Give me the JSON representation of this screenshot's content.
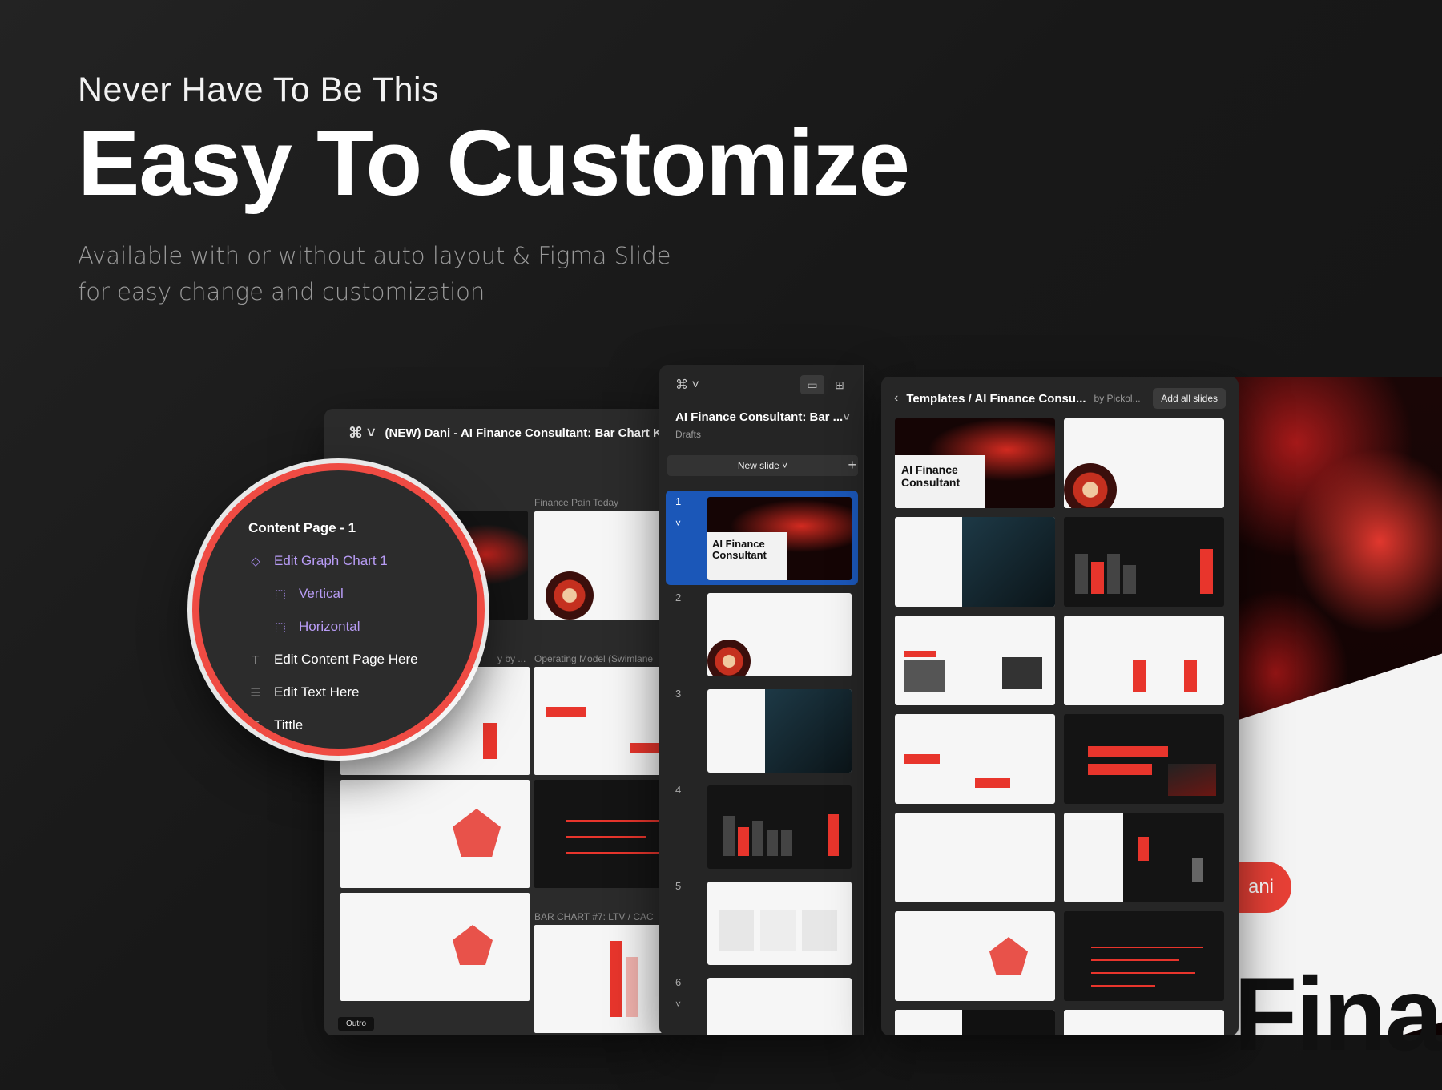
{
  "hero": {
    "kicker": "Never Have To Be This",
    "title": "Easy To Customize",
    "subtitle_line1": "Available with or without auto layout  & Figma Slide",
    "subtitle_line2": "for easy change and customization"
  },
  "back_window": {
    "file_title": "(NEW) Dani - AI Finance Consultant: Bar Chart KPI",
    "labels": {
      "finance_pain": "Finance Pain Today",
      "operating_model": "Operating Model (Swimlane",
      "by": "y by ...",
      "bar_chart7": "BAR CHART #7: LTV / CAC"
    },
    "outro": "Outro"
  },
  "layers": {
    "root": "Content Page - 1",
    "items": [
      {
        "label": "Edit Graph Chart 1",
        "icon": "component-icon"
      },
      {
        "label": "Vertical",
        "icon": "frame-icon"
      },
      {
        "label": "Horizontal",
        "icon": "frame-icon"
      },
      {
        "label": "Edit Content Page Here",
        "icon": "text-icon"
      },
      {
        "label": "Edit Text Here",
        "icon": "auto-layout-icon"
      },
      {
        "label": "Tittle",
        "icon": "text-icon"
      }
    ]
  },
  "slides_panel": {
    "deck_name": "AI Finance Consultant: Bar ...",
    "location": "Drafts",
    "new_slide": "New slide",
    "slide_numbers": [
      "1",
      "2",
      "3",
      "4",
      "5",
      "6"
    ],
    "cover_title_line1": "AI Finance",
    "cover_title_line2": "Consultant"
  },
  "templates_panel": {
    "path": "Templates / AI Finance Consu...",
    "by": "by Pickol...",
    "add_all": "Add all slides",
    "cover_title_line1": "AI Finance",
    "cover_title_line2": "Consultant"
  },
  "artwork": {
    "pill_text": "ani",
    "big_text": "Fina"
  },
  "colors": {
    "accent_red": "#e8352c",
    "selection_blue": "#1b57b8",
    "layer_purple": "#b89cf5"
  }
}
